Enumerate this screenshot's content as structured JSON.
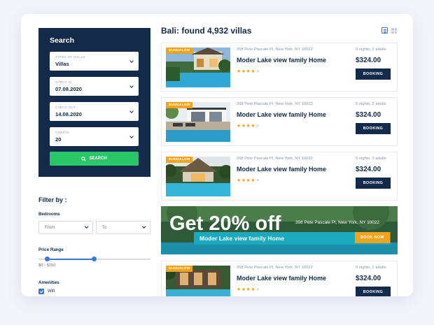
{
  "search": {
    "title": "Search",
    "fields": [
      {
        "label": "TYPES OF VILLAS",
        "value": "Villas"
      },
      {
        "label": "CHECK IN",
        "value": "07.08.2020"
      },
      {
        "label": "CHECK OUT",
        "value": "14.08.2020"
      },
      {
        "label": "GUESTS",
        "value": "20"
      }
    ],
    "button_label": "SEARCH"
  },
  "filter": {
    "title": "Filter by :",
    "bedrooms_label": "Bedrooms",
    "bedrooms_from": "From",
    "bedrooms_to": "To",
    "price_label": "Price Range",
    "price_value": "$0 - $150",
    "price_range_fraction": [
      0.07,
      0.5
    ],
    "amenities_label": "Amenities",
    "amenities": [
      {
        "label": "Wifi",
        "checked": true
      }
    ]
  },
  "results": {
    "title": "Bali: found 4,932 villas",
    "listings": [
      {
        "tag": "BUNGALOW",
        "address": "398 Pete Pascale Pl, New York, NY 10022",
        "name": "Moder Lake view family Home",
        "rating": 4,
        "nights": "5 nights, 2 adults",
        "price": "$324.00",
        "button": "BOOKING"
      },
      {
        "tag": "BUNGALOW",
        "address": "398 Pete Pascale Pl, New York, NY 10022",
        "name": "Moder Lake view family Home",
        "rating": 4,
        "nights": "5 nights, 2 adults",
        "price": "$324.00",
        "button": "BOOKING"
      },
      {
        "tag": "BUNGALOW",
        "address": "398 Pete Pascale Pl, New York, NY 10022",
        "name": "Moder Lake view family Home",
        "rating": 4,
        "nights": "5 nights, 2 adults",
        "price": "$324.00",
        "button": "BOOKING"
      },
      {
        "tag": "BUNGALOW",
        "address": "398 Pete Pascale Pl, New York, NY 10022",
        "name": "Moder Lake view family Home",
        "rating": 4,
        "nights": "5 nights, 2 adults",
        "price": "$324.00",
        "button": "BOOKING"
      }
    ]
  },
  "promo": {
    "headline": "Get 20% off",
    "address": "398 Pete Pascale Pl, New York, NY 10022",
    "name": "Moder Lake view family Home",
    "button": "BOOK NOW"
  },
  "colors": {
    "navy": "#132a4a",
    "green": "#29c767",
    "orange": "#f3a41e",
    "blue": "#3a78d8",
    "teal": "#1baabd"
  }
}
